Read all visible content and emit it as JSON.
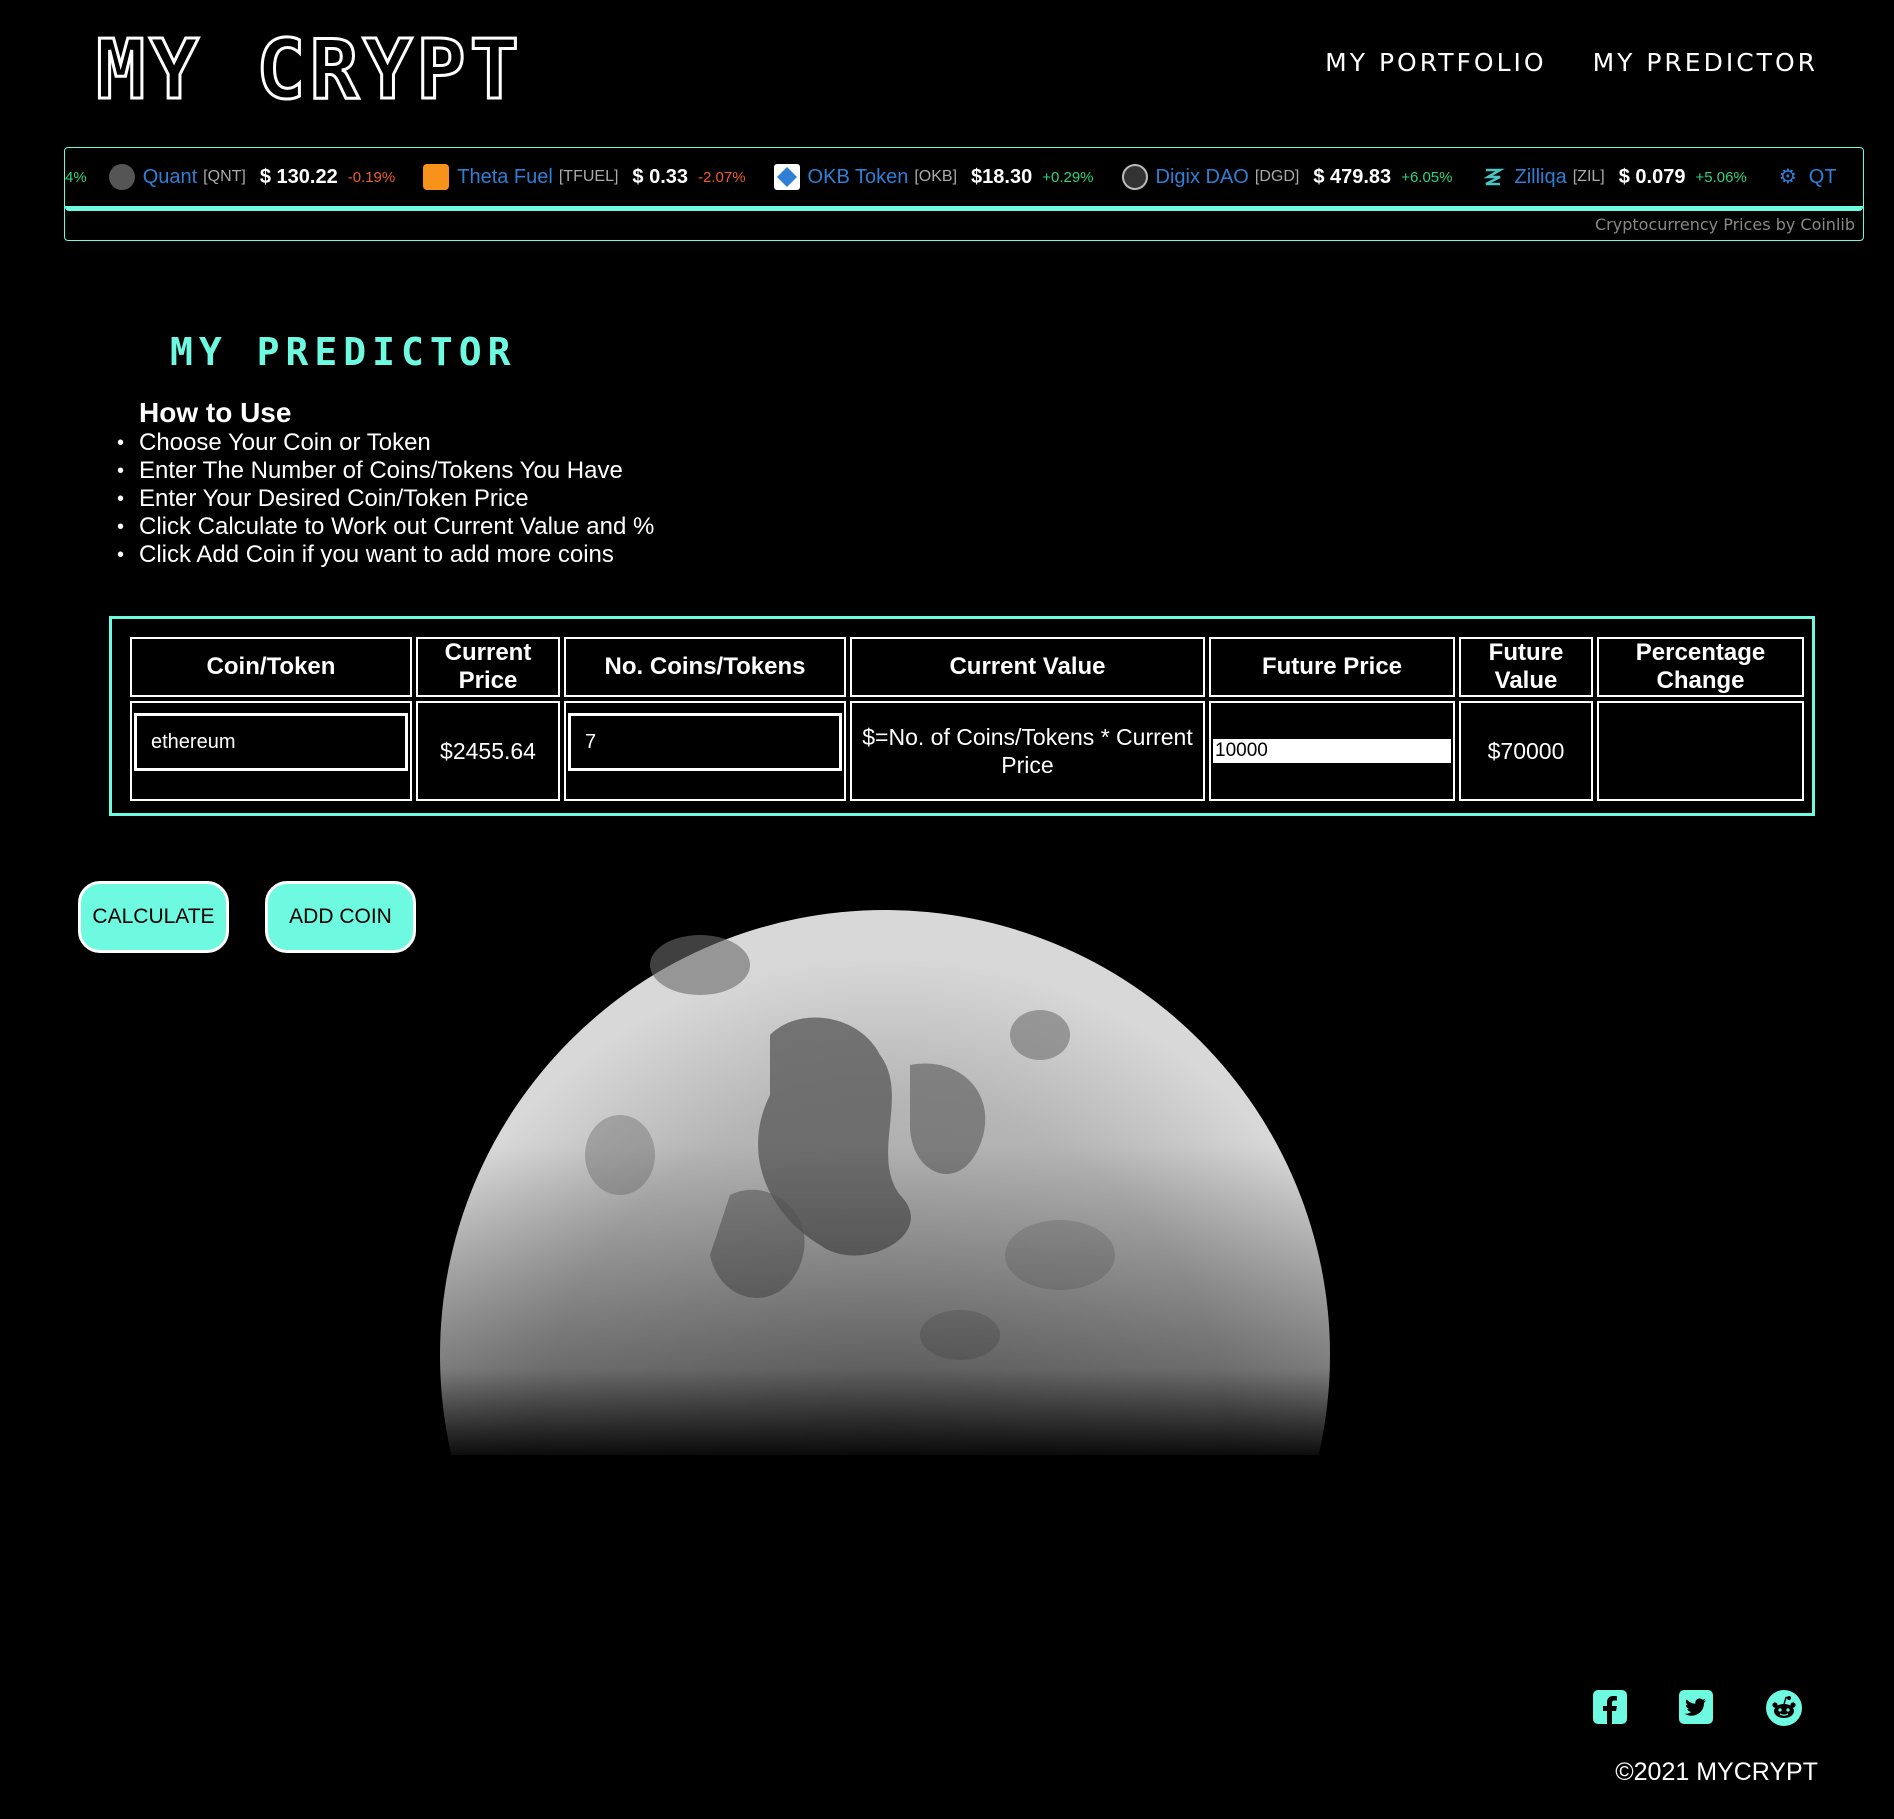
{
  "header": {
    "logo": "MY CRYPT",
    "nav": [
      "MY PORTFOLIO",
      "MY PREDICTOR"
    ]
  },
  "ticker": {
    "lead_change": "4%",
    "items": [
      {
        "name": "Quant",
        "symbol": "[QNT]",
        "price": "$ 130.22",
        "change": "-0.19%",
        "direction": "down",
        "icon": "quant-icon"
      },
      {
        "name": "Theta Fuel",
        "symbol": "[TFUEL]",
        "price": "$ 0.33",
        "change": "-2.07%",
        "direction": "down",
        "icon": "theta-fuel-icon"
      },
      {
        "name": "OKB Token",
        "symbol": "[OKB]",
        "price": "$18.30",
        "change": "+0.29%",
        "direction": "up",
        "icon": "okb-icon"
      },
      {
        "name": "Digix DAO",
        "symbol": "[DGD]",
        "price": "$ 479.83",
        "change": "+6.05%",
        "direction": "up",
        "icon": "digix-icon"
      },
      {
        "name": "Zilliqa",
        "symbol": "[ZIL]",
        "price": "$ 0.079",
        "change": "+5.06%",
        "direction": "up",
        "icon": "zilliqa-icon"
      }
    ],
    "trailing_name": "QT",
    "credit": "Cryptocurrency Prices by Coinlib"
  },
  "predictor": {
    "title": "MY PREDICTOR",
    "howto_heading": "How to Use",
    "howto_steps": [
      "Choose Your Coin or Token",
      "Enter The Number of Coins/Tokens You Have",
      "Enter Your Desired Coin/Token Price",
      "Click Calculate to Work out Current Value and %",
      "Click Add Coin if you want to add more coins"
    ]
  },
  "table": {
    "headers": [
      "Coin/Token",
      "Current Price",
      "No. Coins/Tokens",
      "Current Value",
      "Future Price",
      "Future Value",
      "Percentage Change"
    ],
    "row": {
      "coin": "ethereum",
      "current_price": "$2455.64",
      "num_coins": "7",
      "current_value": "$=No. of Coins/Tokens * Current Price",
      "future_price": "10000",
      "future_value": "$70000",
      "percentage_change": ""
    }
  },
  "buttons": {
    "calculate": "CALCULATE",
    "add_coin": "ADD COIN"
  },
  "footer": {
    "copyright": "©2021 MYCRYPT",
    "social": [
      "facebook-icon",
      "twitter-icon",
      "reddit-icon"
    ]
  },
  "colors": {
    "accent": "#6dfae0",
    "background": "#000000",
    "ticker_name": "#2f7fd6",
    "up": "#2ed47a",
    "down": "#f25c2a"
  }
}
